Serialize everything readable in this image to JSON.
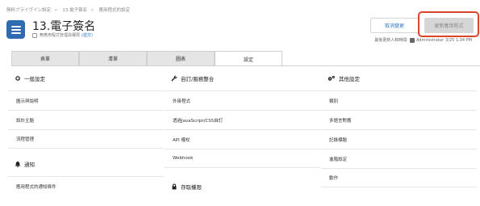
{
  "breadcrumb": [
    "無料プライヴイン設定",
    "13.電子簽名",
    "應用程式的設定"
  ],
  "app": {
    "title": "13.電子簽名",
    "subtitle": "無應用程式管理員權限",
    "subtitle_link": "(遞交)"
  },
  "buttons": {
    "cancel": "取消變更",
    "update": "更新應用程式"
  },
  "modified": {
    "label": "最後更新人和時間:",
    "user": "Administrator",
    "time": "3/25 1:34 PM"
  },
  "tabs": [
    "表單",
    "清單",
    "圖表",
    "設定"
  ],
  "active_tab": "設定",
  "sections": {
    "general": {
      "title": "一般設定",
      "items": [
        "圖示與說明",
        "設計主題",
        "流程管理"
      ]
    },
    "notify": {
      "title": "通知",
      "items": [
        "應用程式的通知條件"
      ]
    },
    "integration": {
      "title": "自訂/服務整合",
      "items": [
        "外掛程式",
        "透過JavaScript/CSS自訂",
        "API 權杖",
        "Webhook"
      ]
    },
    "access": {
      "title": "存取權限"
    },
    "other": {
      "title": "其他設定",
      "items": [
        "類別",
        "多語言對應",
        "記錄標題",
        "進階設定",
        "動作"
      ]
    }
  },
  "colors": {
    "accent": "#2f78c4",
    "icon_bg": "#2f6bb0",
    "highlight": "#d9472b"
  }
}
